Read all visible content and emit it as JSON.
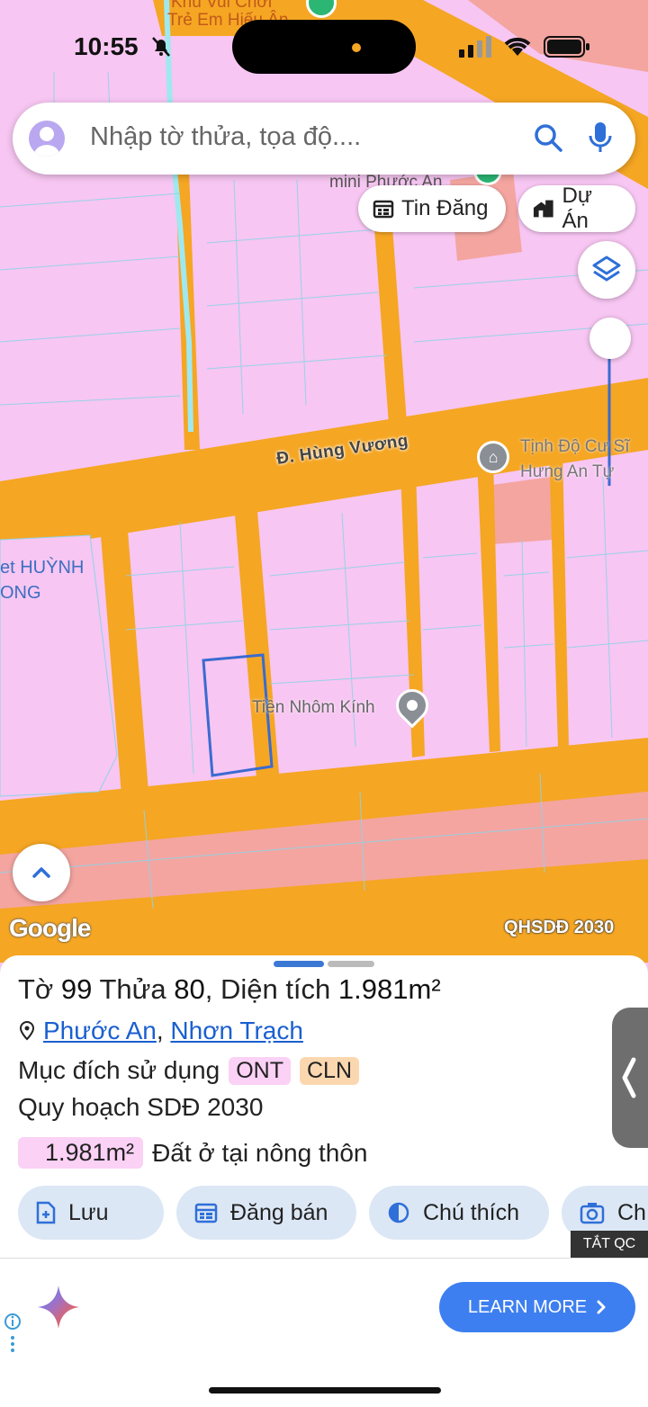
{
  "status": {
    "time": "10:55"
  },
  "search": {
    "placeholder": "Nhập tờ thửa, tọa độ...."
  },
  "map": {
    "chips": {
      "news": "Tin Đăng",
      "projects": "Dự Án"
    },
    "labels": {
      "road": "Đ. Hùng Vương",
      "temple_line1": "Tịnh Độ Cư Sĩ",
      "temple_line2": "Hưng An Tự",
      "shop": "Tiền Nhôm Kính",
      "market_line1": "et HUỲNH",
      "market_line2": "ONG",
      "top_line1": "Khu Vui Chơi",
      "top_line2": "Trẻ Em Hiếu Ân",
      "mini": "mini Phước An"
    },
    "attribution": "Google",
    "plan_badge": "QHSDĐ 2030"
  },
  "parcel": {
    "sheet_label": "Tờ",
    "sheet": "99",
    "plot_label": "Thửa",
    "plot": "80",
    "area_label": "Diện tích",
    "area": "1.981m²",
    "ward": "Phước An",
    "district": "Nhơn Trạch",
    "purpose_label": "Mục đích sử dụng",
    "purpose_tags": [
      "ONT",
      "CLN"
    ],
    "plan_label": "Quy hoạch SDĐ 2030",
    "plan_area": "1.981m²",
    "plan_use": "Đất ở tại nông thôn"
  },
  "actions": {
    "save": "Lưu",
    "post": "Đăng bán",
    "legend": "Chú thích",
    "capture": "Ch"
  },
  "ad": {
    "hide_label": "TẮT QC",
    "cta": "LEARN MORE"
  },
  "colors": {
    "land": "#f7c6f2",
    "road": "#f5a623",
    "accent": "#3a78d4",
    "tag_ont": "#fbd1f5",
    "tag_cln": "#fbd7b0"
  }
}
